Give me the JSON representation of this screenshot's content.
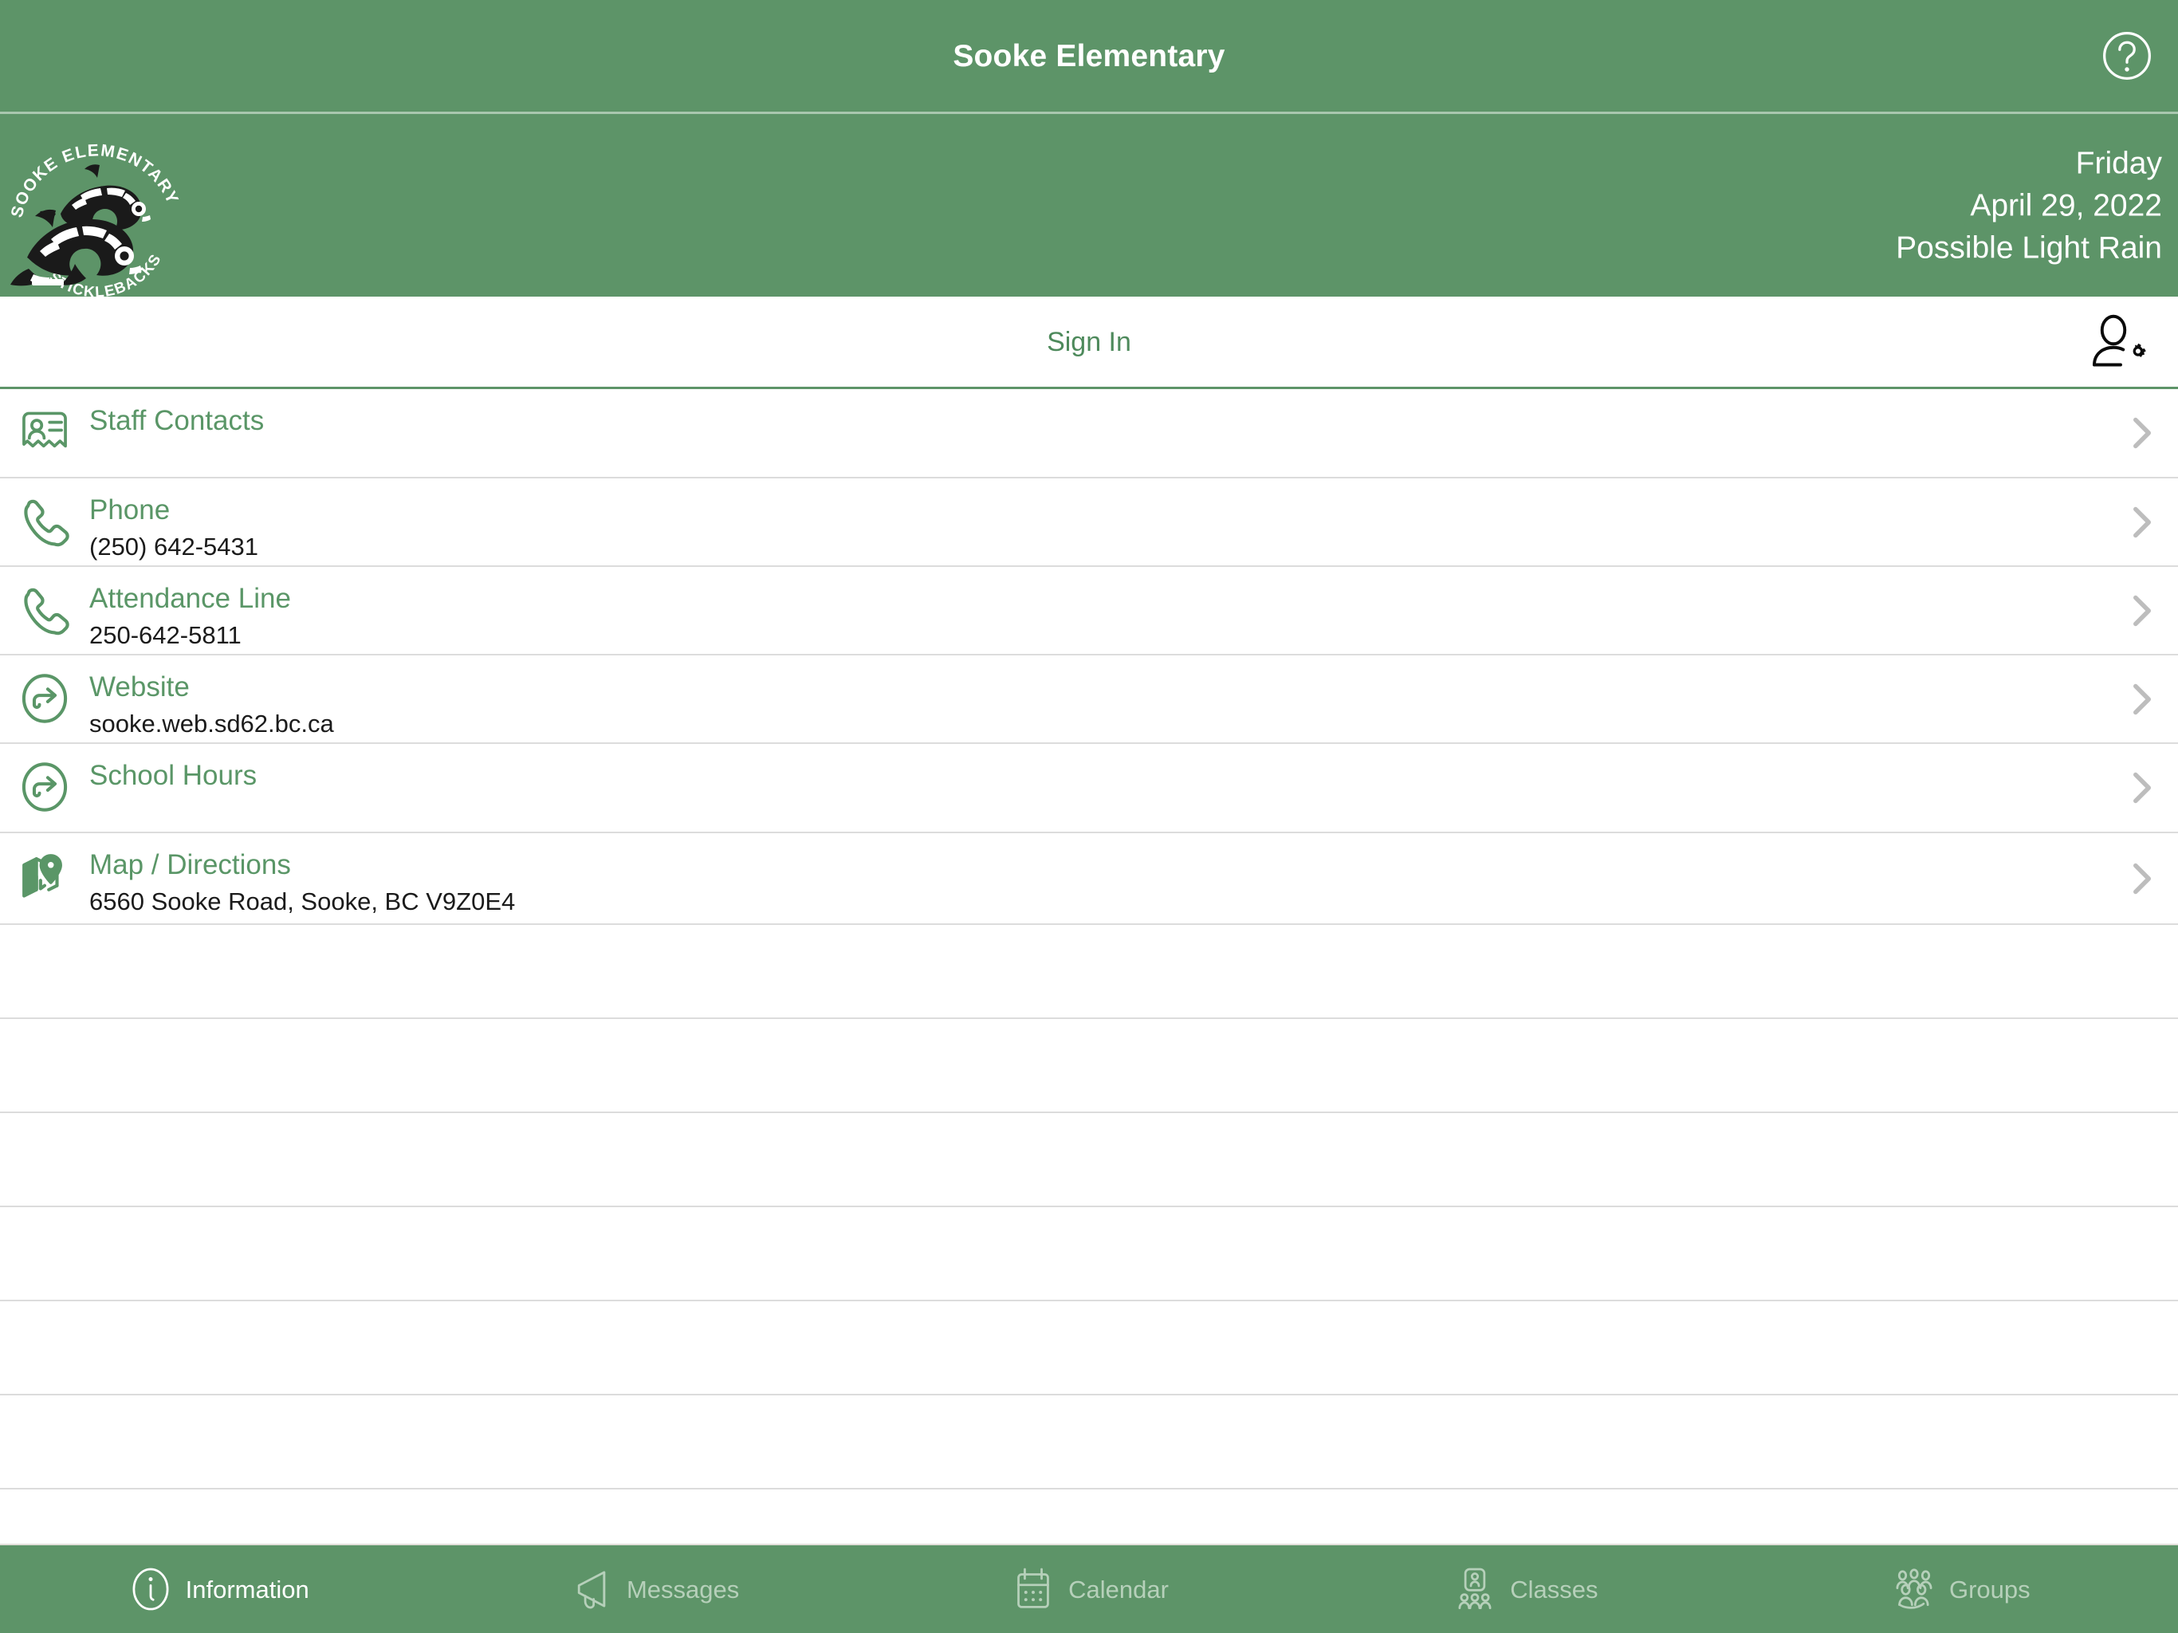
{
  "header": {
    "title": "Sooke Elementary",
    "help_icon": "help-circle-icon",
    "logo_alt": "Sooke Elementary Sticklebacks logo",
    "logo_text_top": "SOOKE ELEMENTARY",
    "logo_text_bottom": "STICKLEBACKS",
    "weekday": "Friday",
    "date": "April 29, 2022",
    "weather": "Possible Light Rain"
  },
  "signin": {
    "label": "Sign In",
    "account_icon": "user-settings-icon"
  },
  "list": {
    "rows": [
      {
        "icon": "id-card-icon",
        "title": "Staff Contacts",
        "subtitle": "",
        "chevron": "chevron-right-icon"
      },
      {
        "icon": "phone-icon",
        "title": "Phone",
        "subtitle": "(250) 642-5431",
        "chevron": "chevron-right-icon"
      },
      {
        "icon": "phone-icon",
        "title": "Attendance Line",
        "subtitle": "250-642-5811",
        "chevron": "chevron-right-icon"
      },
      {
        "icon": "external-link-icon",
        "title": "Website",
        "subtitle": "sooke.web.sd62.bc.ca",
        "chevron": "chevron-right-icon"
      },
      {
        "icon": "external-link-icon",
        "title": "School Hours",
        "subtitle": "",
        "chevron": "chevron-right-icon"
      },
      {
        "icon": "map-pin-icon",
        "title": "Map / Directions",
        "subtitle": "6560 Sooke Road, Sooke, BC V9Z0E4",
        "chevron": "chevron-right-icon"
      }
    ],
    "empty_row_count": 6
  },
  "tabs": [
    {
      "label": "Information",
      "icon": "info-circle-icon",
      "active": true
    },
    {
      "label": "Messages",
      "icon": "megaphone-icon",
      "active": false
    },
    {
      "label": "Calendar",
      "icon": "calendar-icon",
      "active": false
    },
    {
      "label": "Classes",
      "icon": "classes-icon",
      "active": false
    },
    {
      "label": "Groups",
      "icon": "groups-icon",
      "active": false
    }
  ],
  "colors": {
    "brand_green": "#5D9468",
    "title_green": "#5a9667",
    "tab_inactive": "#b6d0ba",
    "separator": "#dcdcdc",
    "body_text": "#1b1b1b"
  }
}
